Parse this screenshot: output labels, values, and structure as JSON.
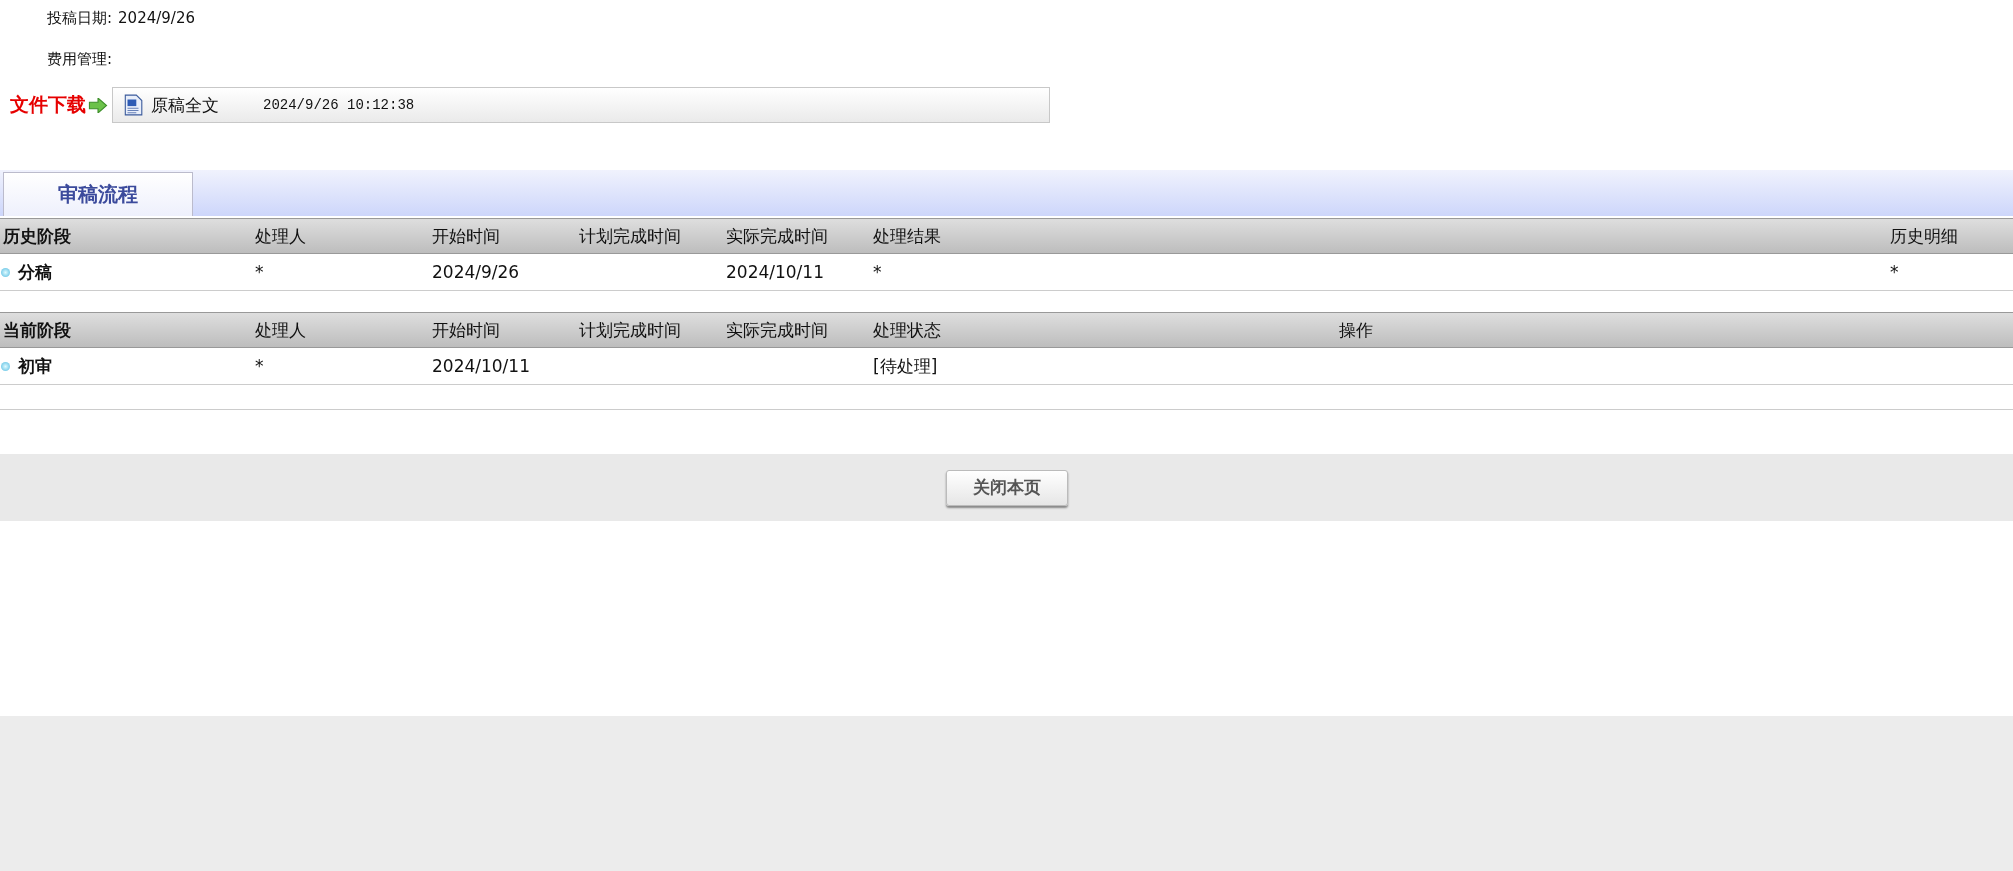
{
  "fields": [
    {
      "label": "投稿日期:",
      "value": "2024/9/26"
    },
    {
      "label": "费用管理:"
    }
  ],
  "download": {
    "label": "文件下载",
    "file_name": "原稿全文",
    "timestamp": "2024/9/26 10:12:38"
  },
  "tabs": [
    {
      "label": "审稿流程",
      "selected": true
    }
  ],
  "history_table": {
    "columns": [
      "历史阶段",
      "处理人",
      "开始时间",
      "计划完成时间",
      "实际完成时间",
      "处理结果",
      "历史明细"
    ],
    "rows": [
      {
        "cells": [
          "分稿",
          "*",
          "2024/9/26",
          "",
          "2024/10/11",
          "*",
          "*"
        ]
      }
    ]
  },
  "current_table": {
    "columns": [
      "当前阶段",
      "处理人",
      "开始时间",
      "计划完成时间",
      "实际完成时间",
      "处理状态",
      "操作"
    ],
    "rows": [
      {
        "cells": [
          "初审",
          "*",
          "2024/10/11",
          "",
          "",
          "[待处理]",
          ""
        ]
      }
    ]
  },
  "buttons": [
    "关闭本页"
  ]
}
